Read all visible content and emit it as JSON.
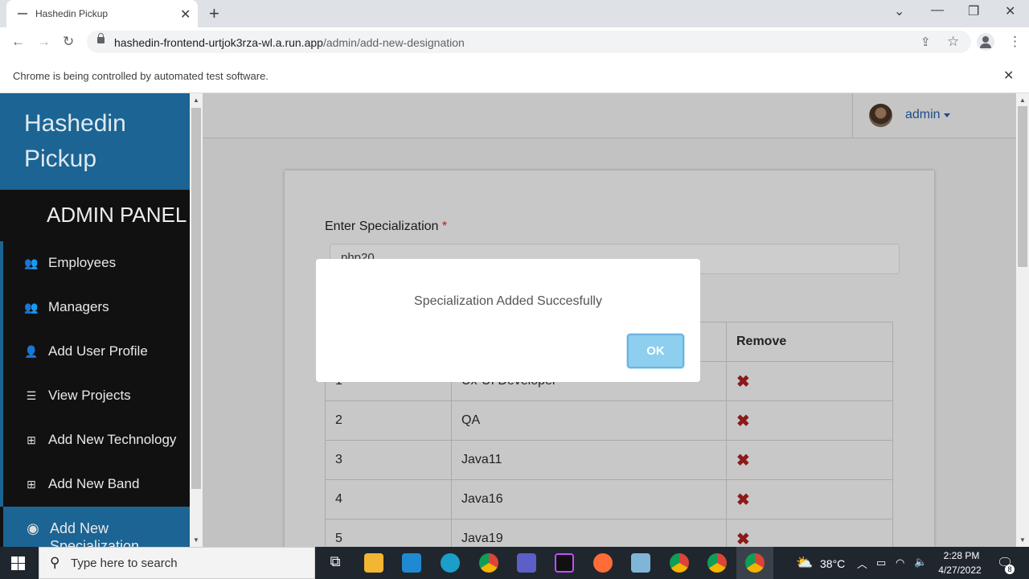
{
  "browser": {
    "tab_title": "Hashedin Pickup",
    "url_host": "hashedin-frontend-urtjok3rza-wl.a.run.app",
    "url_path": "/admin/add-new-designation",
    "infobar_text": "Chrome is being controlled by automated test software."
  },
  "sidebar": {
    "brand": "Hashedin Pickup",
    "panel_title": "ADMIN PANEL",
    "items": [
      {
        "label": "Employees",
        "icon": "users-icon"
      },
      {
        "label": "Managers",
        "icon": "users-icon"
      },
      {
        "label": "Add User Profile",
        "icon": "user-plus-icon"
      },
      {
        "label": "View Projects",
        "icon": "list-icon"
      },
      {
        "label": "Add New Technology",
        "icon": "plus-square-icon"
      },
      {
        "label": "Add New Band",
        "icon": "plus-square-outline-icon"
      },
      {
        "label": "Add New Specialization",
        "icon": "user-circle-icon"
      }
    ]
  },
  "header": {
    "user_name": "admin"
  },
  "form": {
    "label": "Enter Specialization",
    "required_mark": "*",
    "input_value": "php20"
  },
  "table": {
    "remove_header": "Remove",
    "rows": [
      {
        "id": "1",
        "name": "Ux-UI Developer"
      },
      {
        "id": "2",
        "name": "QA"
      },
      {
        "id": "3",
        "name": "Java11"
      },
      {
        "id": "4",
        "name": "Java16"
      },
      {
        "id": "5",
        "name": "Java19"
      }
    ]
  },
  "modal": {
    "message": "Specialization Added Succesfully",
    "ok_label": "OK"
  },
  "taskbar": {
    "search_placeholder": "Type here to search",
    "weather": "38°C",
    "time": "2:28 PM",
    "date": "4/27/2022",
    "notifications": "8"
  }
}
